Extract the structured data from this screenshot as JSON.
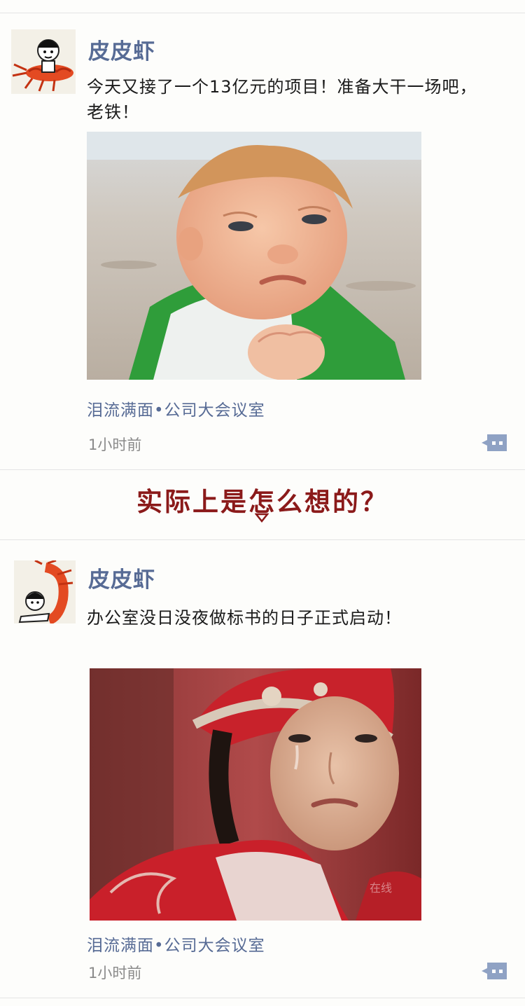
{
  "divider": {
    "heading": "实际上是怎么想的？"
  },
  "posts": [
    {
      "author": "皮皮虾",
      "message": "今天又接了一个13亿元的项目！准备大干一场吧，老铁！",
      "location": "泪流满面•公司大会议室",
      "time": "1小时前",
      "photo_icon": "determined-baby-photo"
    },
    {
      "author": "皮皮虾",
      "message": "办公室没日没夜做标书的日子正式启动！",
      "location": "泪流满面•公司大会议室",
      "time": "1小时前",
      "photo_icon": "crying-man-photo",
      "photo_watermark": "在线"
    }
  ],
  "colors": {
    "author": "#576b95",
    "heading": "#8b1a1a",
    "comment_button": "#8fa2c4"
  }
}
